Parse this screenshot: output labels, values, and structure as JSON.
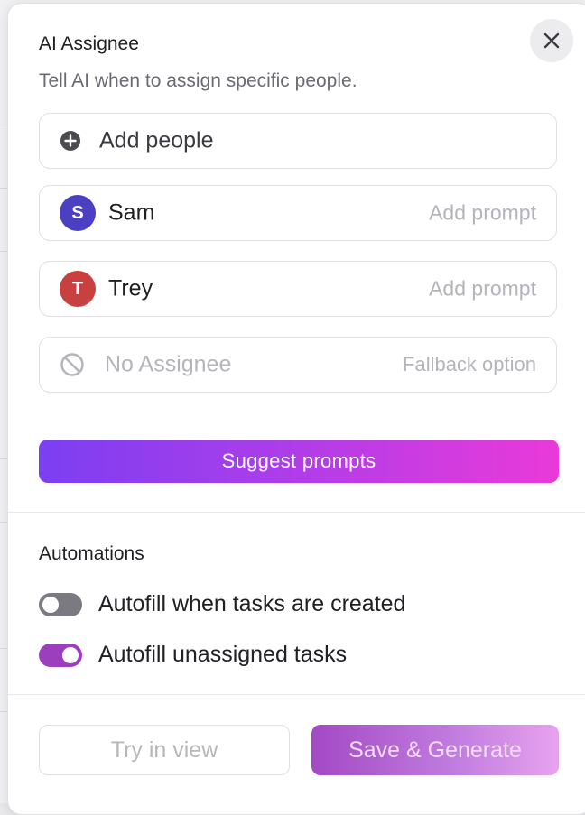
{
  "header": {
    "title": "AI Assignee",
    "subtitle": "Tell AI when to assign specific people."
  },
  "close": {
    "icon": "close-icon"
  },
  "add_people": {
    "icon": "plus-circle-icon",
    "label": "Add people"
  },
  "assignees": [
    {
      "initial": "S",
      "name": "Sam",
      "hint": "Add prompt",
      "color": "#4b3fc2"
    },
    {
      "initial": "T",
      "name": "Trey",
      "hint": "Add prompt",
      "color": "#c8403f"
    }
  ],
  "no_assignee": {
    "icon": "block-icon",
    "label": "No Assignee",
    "hint": "Fallback option"
  },
  "suggest_button": {
    "label": "Suggest prompts"
  },
  "automations": {
    "title": "Automations",
    "toggles": [
      {
        "label": "Autofill when tasks are created",
        "on": false,
        "color": "#7a7a80"
      },
      {
        "label": "Autofill unassigned tasks",
        "on": true,
        "color": "#9b3fbf"
      }
    ]
  },
  "footer": {
    "try_label": "Try in view",
    "save_label": "Save & Generate"
  }
}
